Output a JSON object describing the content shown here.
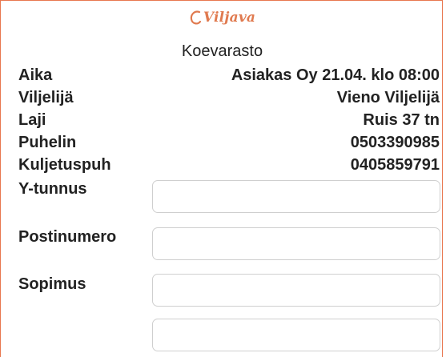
{
  "brand": {
    "logo_text": "Viljava",
    "accent_color": "#e07a4f"
  },
  "title": "Koevarasto",
  "details": [
    {
      "label": "Aika",
      "value": "Asiakas Oy 21.04. klo 08:00"
    },
    {
      "label": "Viljelijä",
      "value": "Vieno Viljelijä"
    },
    {
      "label": "Laji",
      "value": "Ruis 37 tn"
    },
    {
      "label": "Puhelin",
      "value": "0503390985"
    },
    {
      "label": "Kuljetuspuh",
      "value": "0405859791"
    }
  ],
  "fields": [
    {
      "label": "Y-tunnus",
      "value": ""
    },
    {
      "label": "Postinumero",
      "value": ""
    },
    {
      "label": "Sopimus",
      "value": ""
    },
    {
      "label": "",
      "value": ""
    }
  ]
}
